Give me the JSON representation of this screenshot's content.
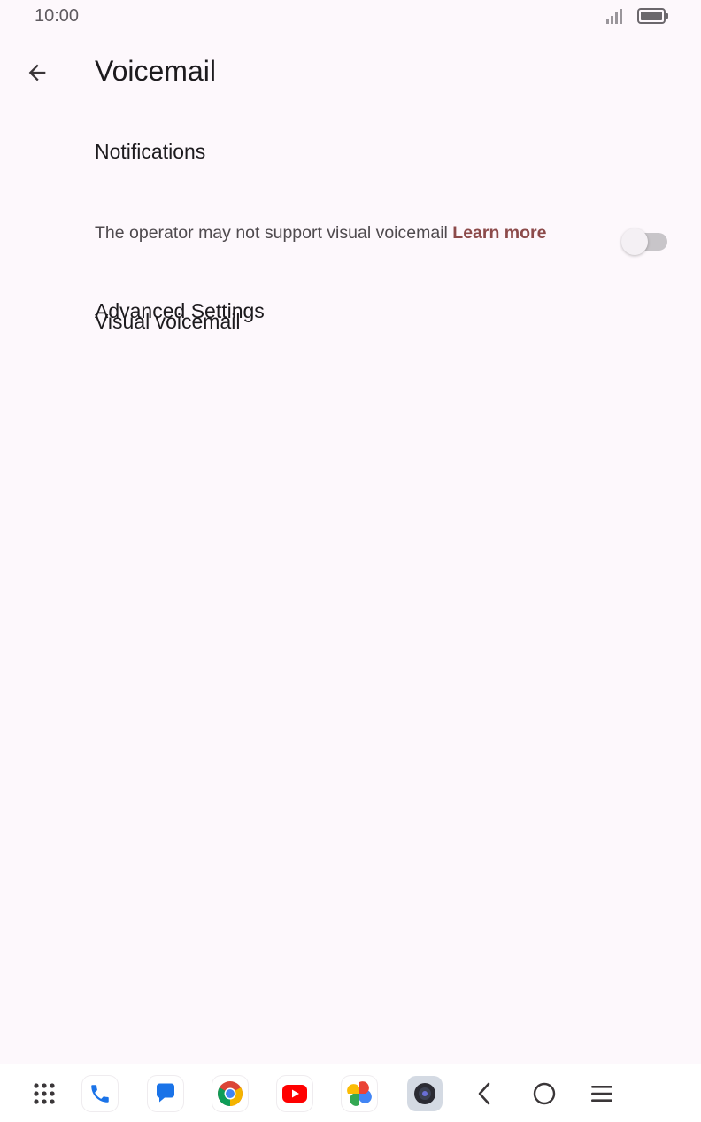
{
  "status_bar": {
    "time": "10:00"
  },
  "header": {
    "title": "Voicemail"
  },
  "settings": {
    "notifications": {
      "title": "Notifications"
    },
    "visual_voicemail": {
      "title": "Visual voicemail",
      "summary": "The operator may not support visual voicemail",
      "link": "Learn more",
      "enabled": false
    },
    "advanced": {
      "title": "Advanced Settings"
    }
  },
  "colors": {
    "background": "#fdf8fc",
    "link": "#8c4a4a"
  },
  "nav_bar": {
    "apps": [
      "apps-grid-icon",
      "phone-icon",
      "messages-icon",
      "chrome-icon",
      "youtube-icon",
      "photos-icon",
      "camera-icon"
    ],
    "system_buttons": [
      "back-icon",
      "home-icon",
      "recents-icon"
    ]
  }
}
